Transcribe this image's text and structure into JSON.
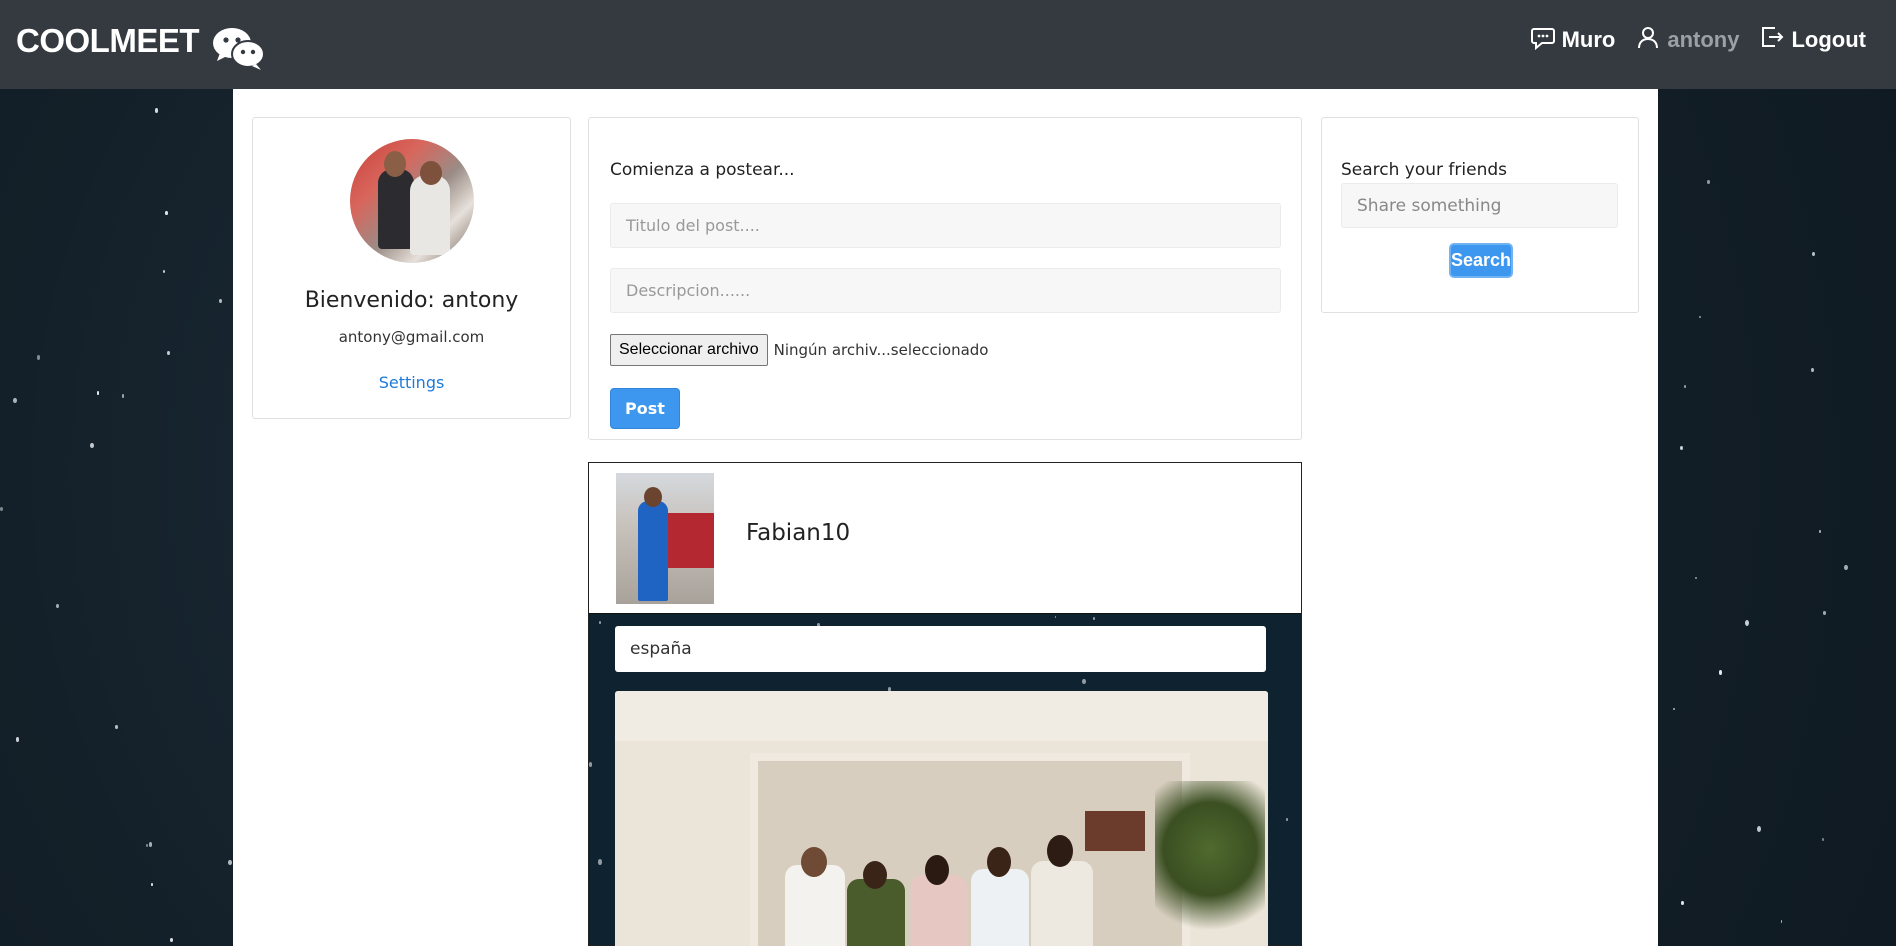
{
  "navbar": {
    "brand": "COOLMEET",
    "brand_icon": "wechat-icon",
    "links": [
      {
        "label": "Muro",
        "icon": "chat-icon"
      },
      {
        "label": "antony",
        "icon": "user-icon"
      },
      {
        "label": "Logout",
        "icon": "logout-icon"
      }
    ]
  },
  "profile": {
    "welcome": "Bienvenido: antony",
    "email": "antony@gmail.com",
    "settings_label": "Settings"
  },
  "composer": {
    "heading": "Comienza a postear...",
    "title_placeholder": "Titulo del post....",
    "description_placeholder": "Descripcion......",
    "file_button": "Seleccionar archivo",
    "file_status": "Ningún archiv...seleccionado",
    "post_label": "Post"
  },
  "search": {
    "heading": "Search your friends",
    "placeholder": "Share something",
    "button_label": "Search"
  },
  "feed": [
    {
      "user": "Fabian10",
      "title": "españa"
    }
  ],
  "colors": {
    "navbar": "#343a40",
    "accent": "#3d97ee",
    "link": "#1e7ad8"
  }
}
